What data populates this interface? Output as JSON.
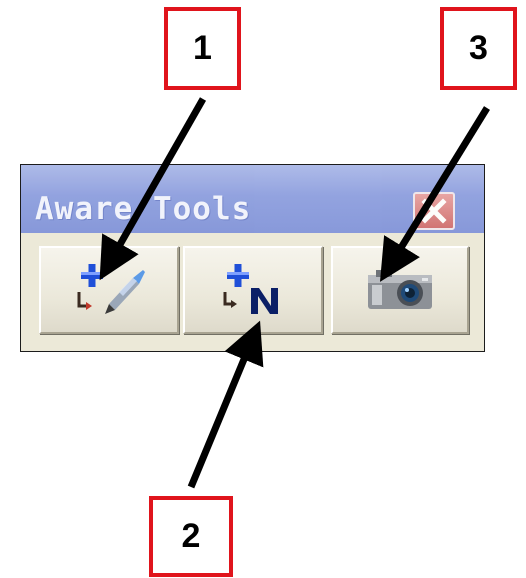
{
  "window": {
    "title": "Aware Tools",
    "close_icon": "close-icon"
  },
  "toolbar": {
    "buttons": [
      {
        "id": 1,
        "icon": "add-plot-pen-icon"
      },
      {
        "id": 2,
        "icon": "add-plot-n-icon"
      },
      {
        "id": 3,
        "icon": "camera-icon"
      }
    ]
  },
  "callouts": {
    "one": "1",
    "two": "2",
    "three": "3"
  },
  "colors": {
    "callout_border": "#e0141c",
    "arrow": "#000000",
    "titlebar": "#8b9de0",
    "toolbar_bg": "#ece9d8"
  }
}
